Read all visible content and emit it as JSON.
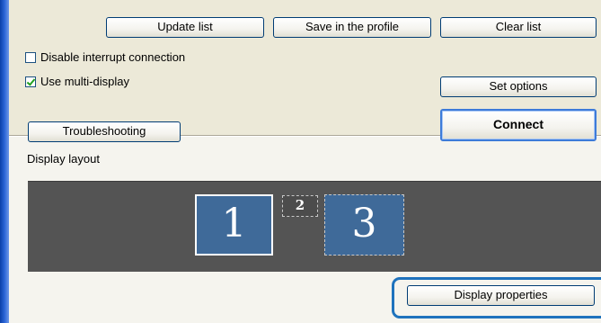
{
  "toolbar": {
    "update_list_label": "Update list",
    "save_profile_label": "Save in the profile",
    "clear_list_label": "Clear list"
  },
  "options": {
    "disable_interrupt": {
      "label": "Disable interrupt connection",
      "checked": false
    },
    "use_multi_display": {
      "label": "Use multi-display",
      "checked": true
    },
    "set_options_label": "Set options"
  },
  "actions": {
    "troubleshooting_label": "Troubleshooting",
    "connect_label": "Connect"
  },
  "layout": {
    "title": "Display layout",
    "monitors": [
      {
        "number": "1",
        "selected": true
      },
      {
        "number": "2",
        "selected": false
      },
      {
        "number": "3",
        "selected": false
      }
    ],
    "display_properties_label": "Display properties"
  },
  "colors": {
    "accent": "#3d7bd9",
    "highlight": "#1f73bd",
    "monitor_fill": "#3f6a99",
    "layout_background": "#545454"
  }
}
